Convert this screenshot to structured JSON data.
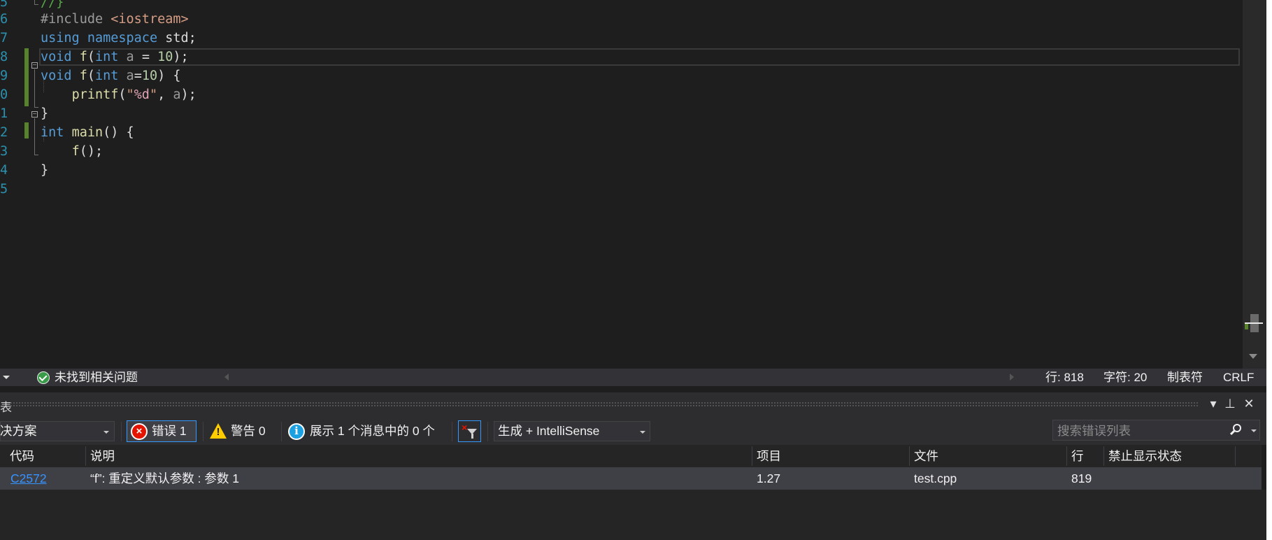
{
  "editor": {
    "line_numbers": [
      "5",
      "6",
      "7",
      "8",
      "9",
      "0",
      "1",
      "2",
      "3",
      "4",
      "5"
    ],
    "lines": [
      [
        {
          "c": "cmt",
          "t": "//}"
        }
      ],
      [
        {
          "c": "pp",
          "t": "#include "
        },
        {
          "c": "inc",
          "t": "<iostream>"
        }
      ],
      [
        {
          "c": "kw",
          "t": "using"
        },
        {
          "c": "id",
          "t": " "
        },
        {
          "c": "kw",
          "t": "namespace"
        },
        {
          "c": "id",
          "t": " std;"
        }
      ],
      [
        {
          "c": "kw",
          "t": "void"
        },
        {
          "c": "id",
          "t": " "
        },
        {
          "c": "fn",
          "t": "f"
        },
        {
          "c": "id",
          "t": "("
        },
        {
          "c": "kw",
          "t": "int"
        },
        {
          "c": "id",
          "t": " "
        },
        {
          "c": "param",
          "t": "a"
        },
        {
          "c": "id",
          "t": " = "
        },
        {
          "c": "num",
          "t": "10"
        },
        {
          "c": "id",
          "t": ");"
        }
      ],
      [
        {
          "c": "kw",
          "t": "void"
        },
        {
          "c": "id",
          "t": " "
        },
        {
          "c": "fn",
          "t": "f"
        },
        {
          "c": "id",
          "t": "("
        },
        {
          "c": "kw",
          "t": "int"
        },
        {
          "c": "id",
          "t": " "
        },
        {
          "c": "param",
          "t": "a"
        },
        {
          "c": "id",
          "t": "="
        },
        {
          "c": "num",
          "t": "10"
        },
        {
          "c": "id",
          "t": ") {"
        }
      ],
      [
        {
          "c": "id",
          "t": "    "
        },
        {
          "c": "fn",
          "t": "printf"
        },
        {
          "c": "id",
          "t": "("
        },
        {
          "c": "str",
          "t": "\""
        },
        {
          "c": "fmt",
          "t": "%d"
        },
        {
          "c": "str",
          "t": "\""
        },
        {
          "c": "id",
          "t": ", "
        },
        {
          "c": "param",
          "t": "a"
        },
        {
          "c": "id",
          "t": ");"
        }
      ],
      [
        {
          "c": "id",
          "t": "}"
        }
      ],
      [
        {
          "c": "kw",
          "t": "int"
        },
        {
          "c": "id",
          "t": " "
        },
        {
          "c": "fn",
          "t": "main"
        },
        {
          "c": "id",
          "t": "() {"
        }
      ],
      [
        {
          "c": "id",
          "t": "    "
        },
        {
          "c": "fn",
          "t": "f"
        },
        {
          "c": "id",
          "t": "();"
        }
      ],
      [
        {
          "c": "id",
          "t": "}"
        }
      ],
      []
    ]
  },
  "editor_status": {
    "issues_text": "未找到相关问题",
    "line": "行: 818",
    "char": "字符: 20",
    "tabs": "制表符",
    "line_ending": "CRLF"
  },
  "error_list": {
    "title_fragment": "表",
    "title_buttons": {
      "dropdown": "▾",
      "pin": "⊥",
      "close": "✕"
    },
    "scope_combo": "决方案",
    "errors_label": "错误 1",
    "warnings_label": "警告 0",
    "messages_label": "展示 1 个消息中的 0 个",
    "source_combo": "生成 + IntelliSense",
    "search_placeholder": "搜索错误列表",
    "columns": {
      "code": "代码",
      "description": "说明",
      "project": "项目",
      "file": "文件",
      "line": "行",
      "suppression": "禁止显示状态"
    },
    "rows": [
      {
        "code": "C2572",
        "description": "“f”: 重定义默认参数 : 参数 1",
        "project": "1.27",
        "file": "test.cpp",
        "line": "819",
        "suppression": ""
      }
    ]
  },
  "colors": {
    "background": "#1e1e1e",
    "keyword": "#569cd6",
    "function": "#dcdcaa",
    "number": "#b5cea8",
    "string": "#d69d85",
    "change_bar": "#57832c",
    "error_red": "#e51400",
    "warning_yellow": "#ffcc00",
    "info_blue": "#1ba1e2",
    "link_blue": "#3794ff"
  }
}
